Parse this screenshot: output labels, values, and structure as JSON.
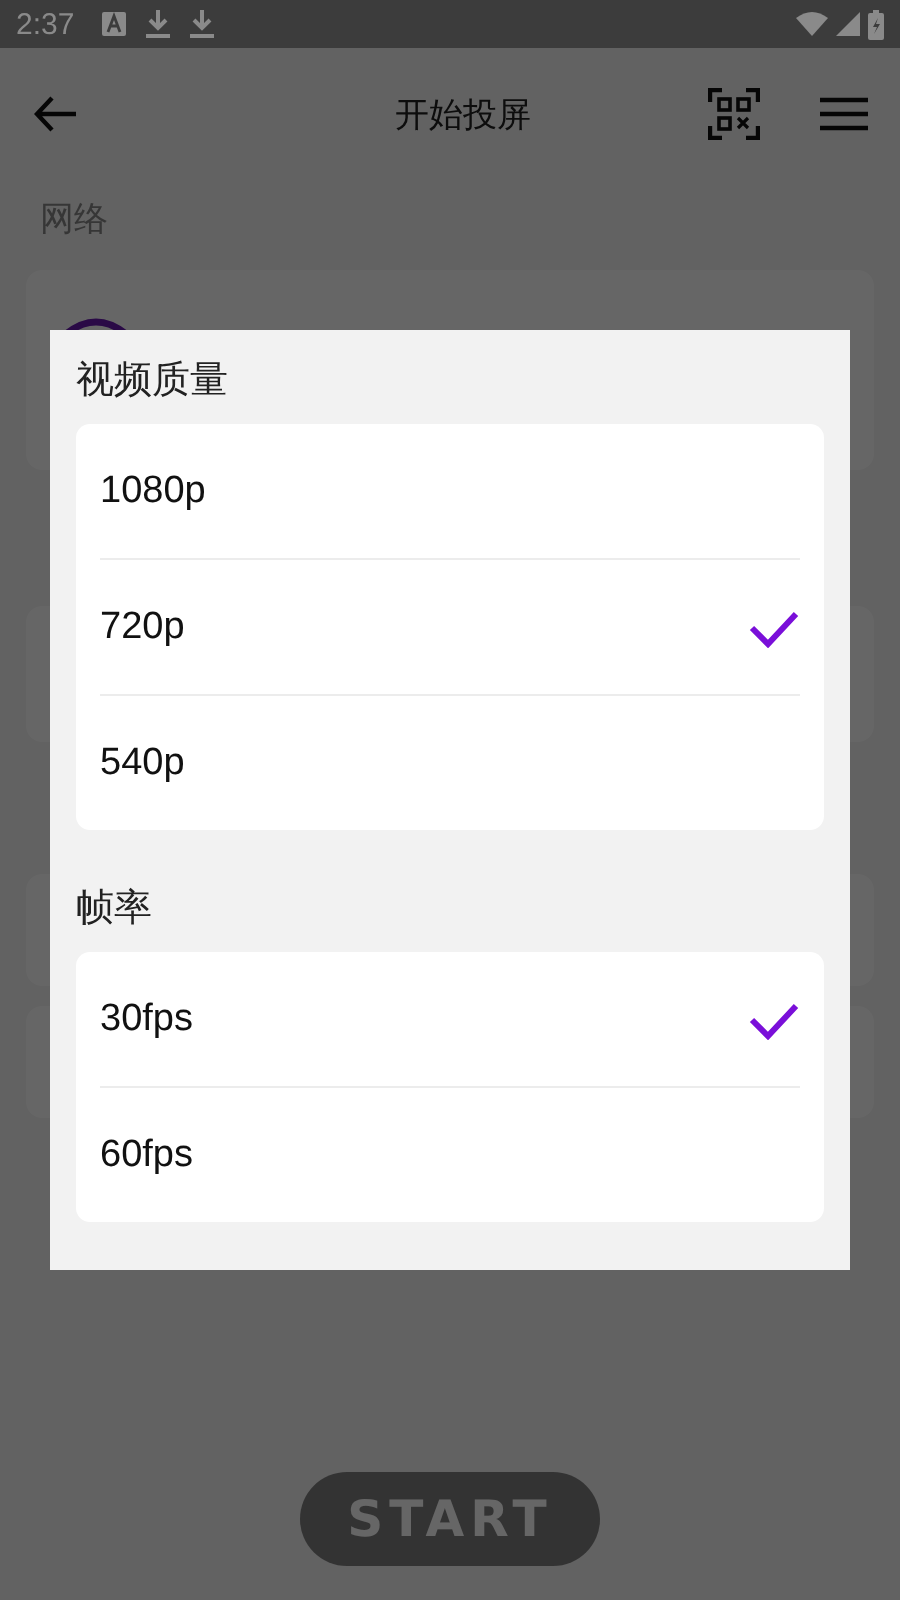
{
  "status_bar": {
    "time": "2:37"
  },
  "app_bar": {
    "title": "开始投屏"
  },
  "network": {
    "label": "网络"
  },
  "start_button": {
    "label": "START"
  },
  "dialog": {
    "groups": [
      {
        "title": "视频质量",
        "options": [
          {
            "label": "1080p",
            "selected": false
          },
          {
            "label": "720p",
            "selected": true
          },
          {
            "label": "540p",
            "selected": false
          }
        ]
      },
      {
        "title": "帧率",
        "options": [
          {
            "label": "30fps",
            "selected": true
          },
          {
            "label": "60fps",
            "selected": false
          }
        ]
      }
    ]
  }
}
